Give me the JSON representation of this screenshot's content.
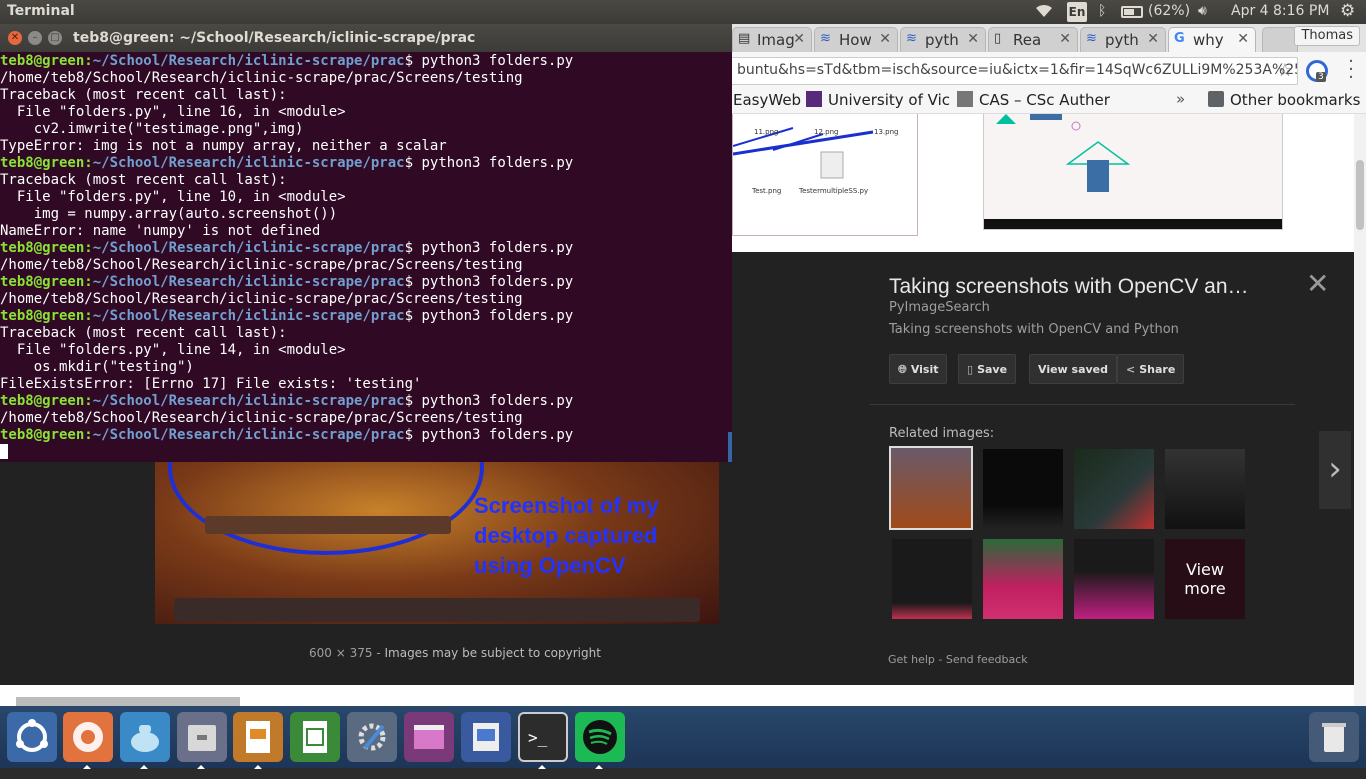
{
  "panel": {
    "app_title": "Terminal",
    "lang": "En",
    "battery": "(62%)",
    "clock": "Apr  4  8:16 PM",
    "icons": [
      "wifi-icon",
      "bluetooth-icon",
      "battery-icon",
      "volume-icon",
      "settings-gear-icon"
    ]
  },
  "browser": {
    "tabs": [
      {
        "label": "Imag",
        "icon": "page-icon"
      },
      {
        "label": "How",
        "icon": "stackoverflow-icon"
      },
      {
        "label": "pyth",
        "icon": "stackoverflow-icon"
      },
      {
        "label": "Rea",
        "icon": "doc-icon"
      },
      {
        "label": "pyth",
        "icon": "stackoverflow-icon"
      },
      {
        "label": "why",
        "icon": "google-icon"
      }
    ],
    "profile": "Thomas",
    "url": "buntu&hs=sTd&tbm=isch&source=iu&ictx=1&fir=14SqWc6ZULLi9M%253A%252Cv...",
    "extension_badge": "3",
    "bookmarks": [
      "EasyWeb",
      "University of Vic",
      "CAS – CSc Auther"
    ],
    "bookmarks_more": "»",
    "other_bookmarks": "Other bookmarks"
  },
  "image_result": {
    "thumb_a_labels": [
      "11.png",
      "12.png",
      "13.png",
      "Test.png",
      "TestermultipleSS.py"
    ],
    "caption": "Screenshot of my desktop captured using OpenCV",
    "size": "600 × 375",
    "copyright": "Images may be subject to copyright",
    "title": "Taking screenshots with OpenCV an…",
    "source": "PyImageSearch",
    "description": "Taking screenshots with OpenCV and Python",
    "actions": [
      {
        "label": "Visit",
        "icon": "globe-icon"
      },
      {
        "label": "Save",
        "icon": "bookmark-icon"
      },
      {
        "label": "View saved",
        "icon": ""
      },
      {
        "label": "Share",
        "icon": "share-icon"
      }
    ],
    "related_label": "Related images:",
    "view_more": "View more",
    "footer_help": "Get help",
    "footer_sep": "-",
    "footer_feedback": "Send feedback"
  },
  "terminal": {
    "title": "teb8@green: ~/School/Research/iclinic-scrape/prac",
    "prompt_user": "teb8@green",
    "prompt_path": "~/School/Research/iclinic-scrape/prac",
    "lines": [
      {
        "type": "prompt",
        "cmd": " python3 folders.py"
      },
      {
        "type": "out",
        "text": "/home/teb8/School/Research/iclinic-scrape/prac/Screens/testing"
      },
      {
        "type": "out",
        "text": "Traceback (most recent call last):"
      },
      {
        "type": "out",
        "text": "  File \"folders.py\", line 16, in <module>"
      },
      {
        "type": "out",
        "text": "    cv2.imwrite(\"testimage.png\",img)"
      },
      {
        "type": "out",
        "text": "TypeError: img is not a numpy array, neither a scalar"
      },
      {
        "type": "prompt",
        "cmd": " python3 folders.py"
      },
      {
        "type": "out",
        "text": "Traceback (most recent call last):"
      },
      {
        "type": "out",
        "text": "  File \"folders.py\", line 10, in <module>"
      },
      {
        "type": "out",
        "text": "    img = numpy.array(auto.screenshot())"
      },
      {
        "type": "out",
        "text": "NameError: name 'numpy' is not defined"
      },
      {
        "type": "prompt",
        "cmd": " python3 folders.py"
      },
      {
        "type": "out",
        "text": "/home/teb8/School/Research/iclinic-scrape/prac/Screens/testing"
      },
      {
        "type": "prompt",
        "cmd": " python3 folders.py"
      },
      {
        "type": "out",
        "text": "/home/teb8/School/Research/iclinic-scrape/prac/Screens/testing"
      },
      {
        "type": "prompt",
        "cmd": " python3 folders.py"
      },
      {
        "type": "out",
        "text": "Traceback (most recent call last):"
      },
      {
        "type": "out",
        "text": "  File \"folders.py\", line 14, in <module>"
      },
      {
        "type": "out",
        "text": "    os.mkdir(\"testing\")"
      },
      {
        "type": "out",
        "text": "FileExistsError: [Errno 17] File exists: 'testing'"
      },
      {
        "type": "prompt",
        "cmd": " python3 folders.py"
      },
      {
        "type": "out",
        "text": "/home/teb8/School/Research/iclinic-scrape/prac/Screens/testing"
      },
      {
        "type": "prompt",
        "cmd": " python3 folders.py"
      },
      {
        "type": "cursor"
      }
    ]
  },
  "launcher": {
    "items": [
      "ubuntu-dash-icon",
      "chromium-icon",
      "tea-icon",
      "files-icon",
      "impress-icon",
      "calc-icon",
      "system-settings-icon",
      "window-icon",
      "writer-doc-icon",
      "terminal-icon",
      "spotify-icon",
      "trash-icon"
    ]
  },
  "colors": {
    "terminal_bg": "#300a24",
    "prompt_user": "#8ae234",
    "prompt_path": "#729fcf",
    "launcher_bg": "#1d3556",
    "panel_bg": "#3c3b37"
  }
}
